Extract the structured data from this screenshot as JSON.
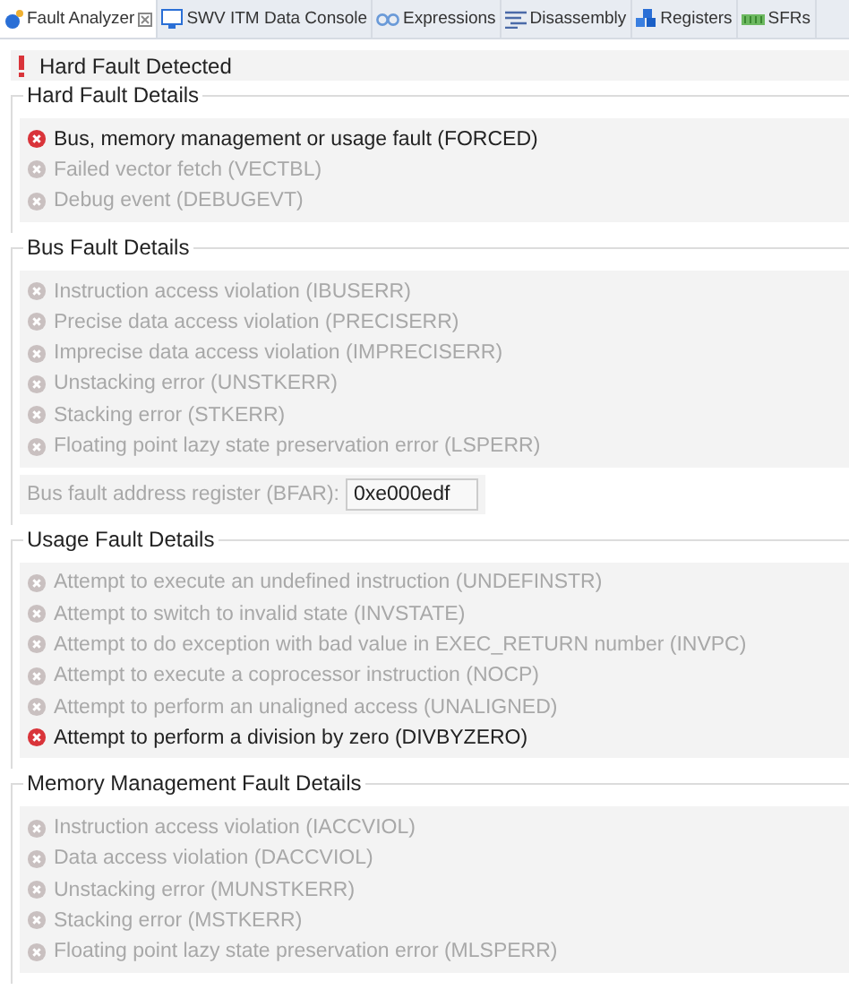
{
  "tabs": [
    {
      "label": "Fault Analyzer",
      "kind": "fault",
      "selected": true
    },
    {
      "label": "SWV ITM Data Console",
      "kind": "console",
      "selected": false
    },
    {
      "label": "Expressions",
      "kind": "expressions",
      "selected": false
    },
    {
      "label": "Disassembly",
      "kind": "disassembly",
      "selected": false
    },
    {
      "label": "Registers",
      "kind": "registers",
      "selected": false
    },
    {
      "label": "SFRs",
      "kind": "sfrs",
      "selected": false
    }
  ],
  "banner": {
    "text": "Hard Fault Detected"
  },
  "sections": [
    {
      "title": "Hard Fault Details",
      "items": [
        {
          "label": "Bus, memory management or usage fault (FORCED)",
          "active": true
        },
        {
          "label": "Failed vector fetch (VECTBL)",
          "active": false
        },
        {
          "label": "Debug event (DEBUGEVT)",
          "active": false
        }
      ]
    },
    {
      "title": "Bus Fault Details",
      "items": [
        {
          "label": "Instruction access violation (IBUSERR)",
          "active": false
        },
        {
          "label": "Precise data access violation (PRECISERR)",
          "active": false
        },
        {
          "label": "Imprecise data access violation (IMPRECISERR)",
          "active": false
        },
        {
          "label": "Unstacking error (UNSTKERR)",
          "active": false
        },
        {
          "label": "Stacking error (STKERR)",
          "active": false
        },
        {
          "label": "Floating point lazy state preservation error (LSPERR)",
          "active": false
        }
      ],
      "field": {
        "label": "Bus fault address register (BFAR):",
        "value": "0xe000edf"
      }
    },
    {
      "title": "Usage Fault Details",
      "items": [
        {
          "label": "Attempt to execute an undefined instruction (UNDEFINSTR)",
          "active": false
        },
        {
          "label": "Attempt to switch to invalid state (INVSTATE)",
          "active": false
        },
        {
          "label": "Attempt to do exception with bad value in EXEC_RETURN number (INVPC)",
          "active": false
        },
        {
          "label": "Attempt to execute a coprocessor instruction (NOCP)",
          "active": false
        },
        {
          "label": "Attempt to perform an unaligned access (UNALIGNED)",
          "active": false
        },
        {
          "label": "Attempt to perform a division by zero (DIVBYZERO)",
          "active": true
        }
      ]
    },
    {
      "title": "Memory Management Fault Details",
      "items": [
        {
          "label": "Instruction access violation (IACCVIOL)",
          "active": false
        },
        {
          "label": "Data access violation (DACCVIOL)",
          "active": false
        },
        {
          "label": "Unstacking error (MUNSTKERR)",
          "active": false
        },
        {
          "label": "Stacking error (MSTKERR)",
          "active": false
        },
        {
          "label": "Floating point lazy state preservation error (MLSPERR)",
          "active": false
        }
      ]
    }
  ]
}
